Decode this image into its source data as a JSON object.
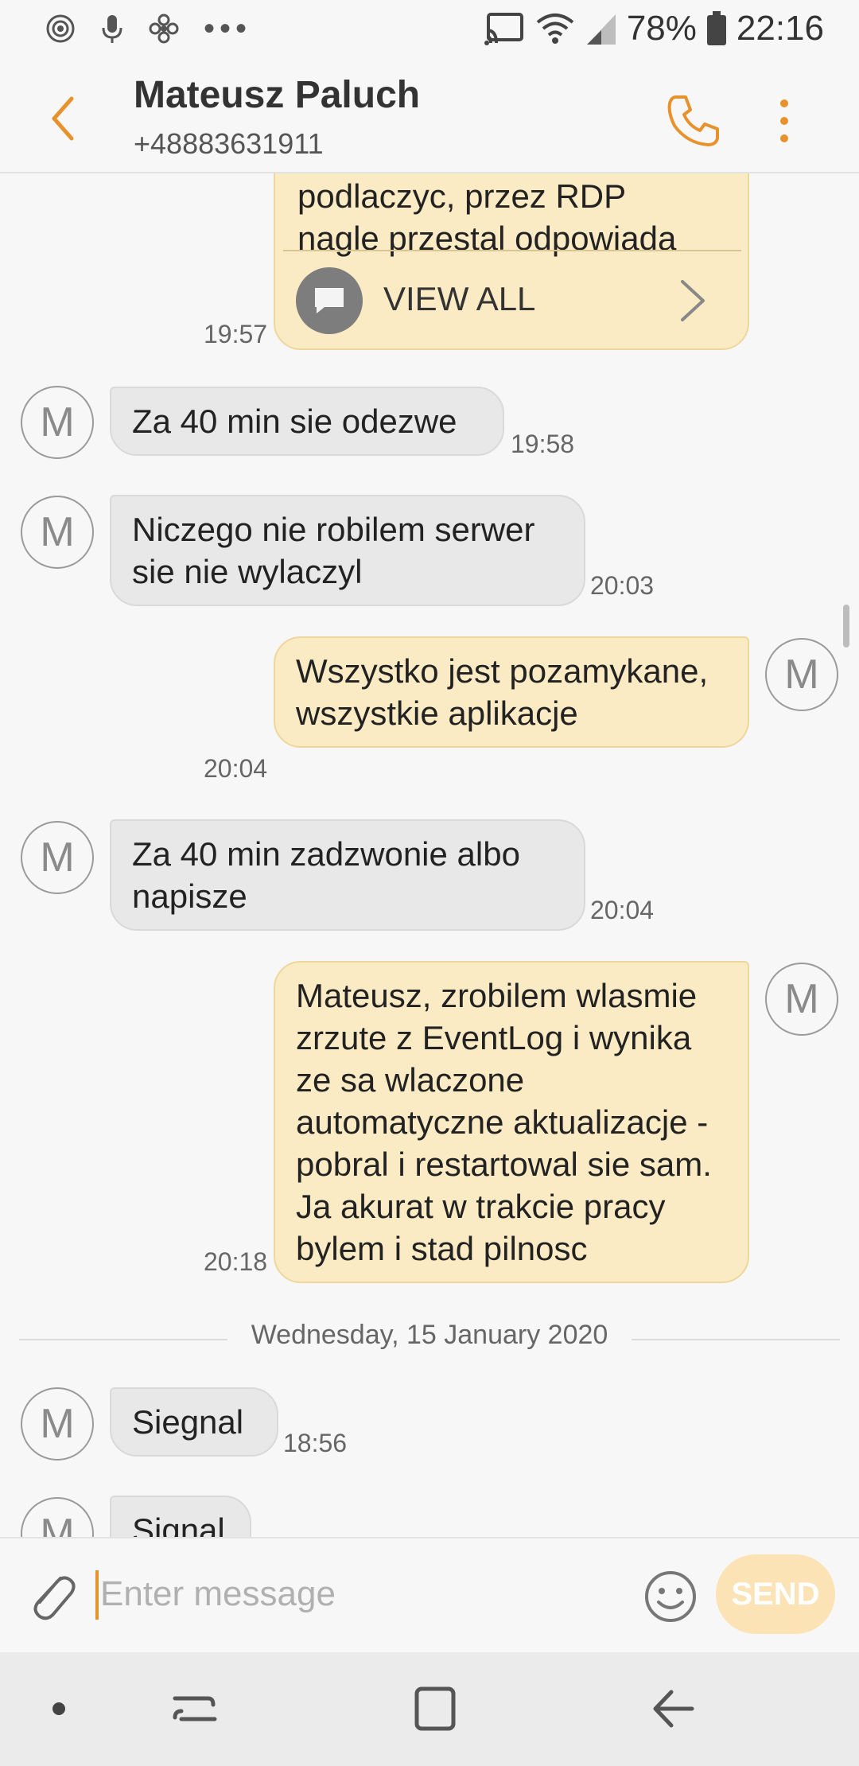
{
  "status_bar": {
    "battery": "78%",
    "time": "22:16"
  },
  "header": {
    "contact_name": "Mateusz Paluch",
    "phone_number": "+48883631911"
  },
  "messages": [
    {
      "direction": "out",
      "text_lines": [
        "podlaczyc, przez RDP",
        "nagle przestal odpowiada"
      ],
      "view_all_label": "VIEW ALL",
      "time": "19:57"
    },
    {
      "direction": "in",
      "avatar_letter": "M",
      "text": "Za 40 min sie odezwe",
      "time": "19:58"
    },
    {
      "direction": "in",
      "avatar_letter": "M",
      "text": "Niczego nie robilem serwer sie nie wylaczyl",
      "time": "20:03"
    },
    {
      "direction": "out",
      "avatar_letter": "M",
      "text": "Wszystko jest pozamykane, wszystkie aplikacje",
      "time": "20:04"
    },
    {
      "direction": "in",
      "avatar_letter": "M",
      "text": "Za 40 min zadzwonie albo napisze",
      "time": "20:04"
    },
    {
      "direction": "out",
      "avatar_letter": "M",
      "text": "Mateusz, zrobilem wlasmie zrzute z EventLog i wynika ze sa wlaczone automatyczne aktualizacje - pobral i restartowal sie sam. Ja akurat w trakcie pracy bylem i stad pilnosc",
      "time": "20:18"
    },
    {
      "direction": "in",
      "avatar_letter": "M",
      "text": "Siegnal",
      "time": "18:56"
    },
    {
      "direction": "in",
      "avatar_letter": "M",
      "text": "Signal",
      "time": ""
    }
  ],
  "date_divider": "Wednesday, 15 January 2020",
  "input": {
    "placeholder": "Enter message",
    "value": "",
    "send_label": "SEND"
  },
  "colors": {
    "accent": "#e8922e",
    "outgoing_bubble": "#fbebc4",
    "incoming_bubble": "#e8e8e8",
    "send_button_disabled": "#fce3b6"
  },
  "icons": {
    "back": "chevron-left-icon",
    "call": "phone-icon",
    "more": "more-vert-icon",
    "attach": "paperclip-icon",
    "emoji": "smiley-icon",
    "view_all": "message-icon"
  }
}
